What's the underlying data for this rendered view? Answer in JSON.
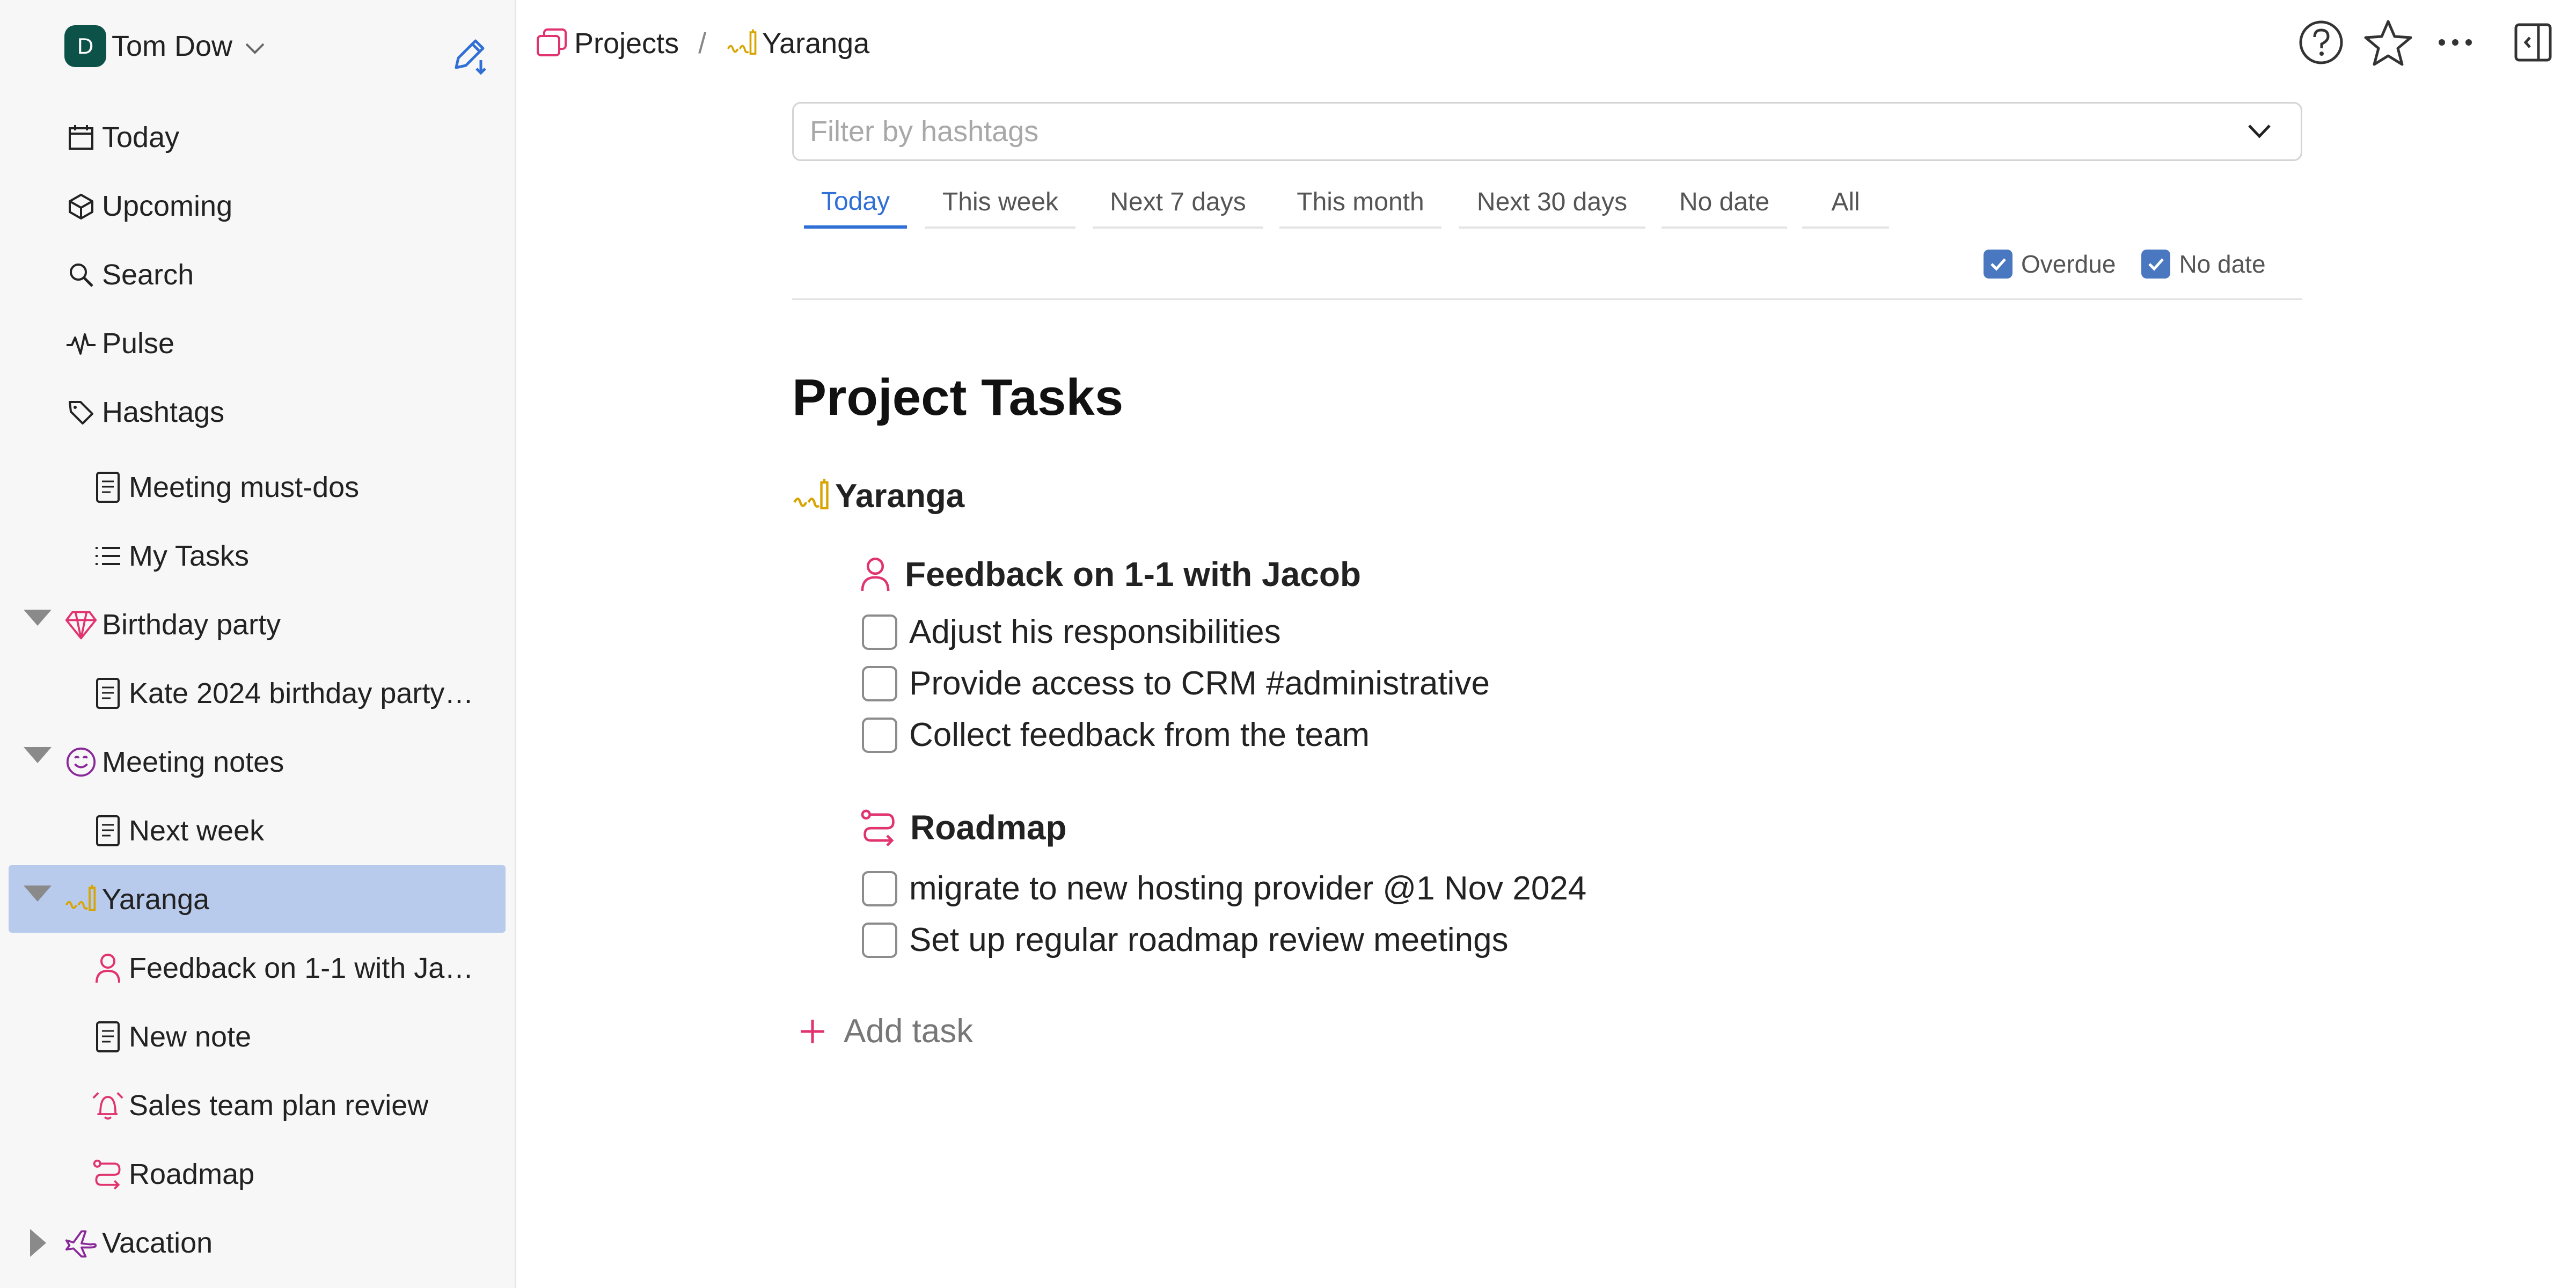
{
  "sidebar": {
    "user": {
      "initial": "D",
      "name": "Tom Dow"
    },
    "items": [
      {
        "label": "Today",
        "icon": "calendar-icon"
      },
      {
        "label": "Upcoming",
        "icon": "cube-icon"
      },
      {
        "label": "Search",
        "icon": "search-icon"
      },
      {
        "label": "Pulse",
        "icon": "pulse-icon"
      },
      {
        "label": "Hashtags",
        "icon": "tag-icon"
      },
      {
        "label": "Meeting must-dos",
        "icon": "note-icon"
      },
      {
        "label": "My Tasks",
        "icon": "list-icon"
      },
      {
        "label": "Birthday party",
        "icon": "diamond-icon"
      },
      {
        "label": "Kate 2024 birthday party…",
        "icon": "note-icon"
      },
      {
        "label": "Meeting notes",
        "icon": "smile-icon"
      },
      {
        "label": "Next week",
        "icon": "note-icon"
      },
      {
        "label": "Yaranga",
        "icon": "yaranga-icon"
      },
      {
        "label": "Feedback on 1-1 with Ja…",
        "icon": "person-icon"
      },
      {
        "label": "New note",
        "icon": "note-icon"
      },
      {
        "label": "Sales team plan review",
        "icon": "alarm-icon"
      },
      {
        "label": "Roadmap",
        "icon": "route-icon"
      },
      {
        "label": "Vacation",
        "icon": "plane-icon"
      }
    ]
  },
  "breadcrumb": {
    "root": "Projects",
    "separator": "/",
    "current": "Yaranga"
  },
  "filter": {
    "placeholder": "Filter by hashtags"
  },
  "tabs": [
    "Today",
    "This week",
    "Next 7 days",
    "This month",
    "Next 30 days",
    "No date",
    "All"
  ],
  "active_tab": "Today",
  "toggles": [
    {
      "label": "Overdue",
      "checked": true
    },
    {
      "label": "No date",
      "checked": true
    }
  ],
  "content": {
    "title": "Project Tasks",
    "project": "Yaranga",
    "groups": [
      {
        "title": "Feedback on 1-1 with Jacob",
        "icon": "person-icon",
        "tasks": [
          "Adjust his responsibilities",
          "Provide access to CRM #administrative",
          "Collect feedback from the team"
        ]
      },
      {
        "title": "Roadmap",
        "icon": "route-icon",
        "tasks": [
          "migrate to new hosting provider @1 Nov 2024",
          "Set up regular roadmap review meetings"
        ]
      }
    ],
    "add_task": "Add task"
  },
  "colors": {
    "accent": "#2f6fd6",
    "pink": "#e0336f",
    "gold": "#d9a300",
    "selected": "#b8cbec",
    "avatar": "#0d5248",
    "purple": "#8a2a9a"
  }
}
